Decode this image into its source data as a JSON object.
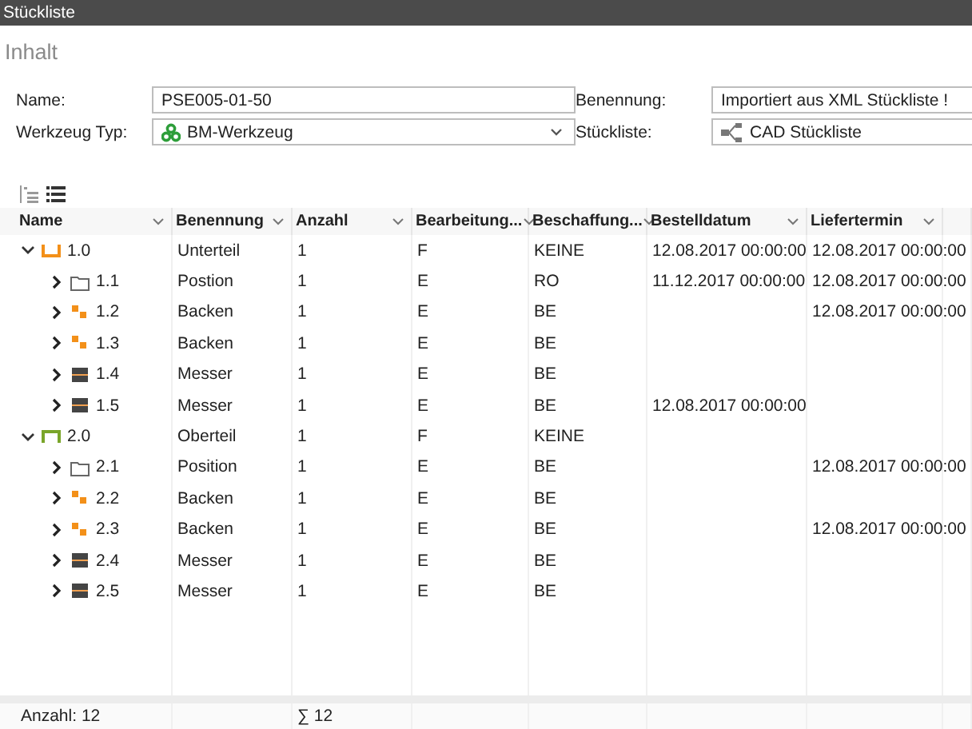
{
  "window": {
    "title": "Stückliste"
  },
  "section": {
    "title": "Inhalt"
  },
  "form": {
    "fields": [
      {
        "label": "Name:",
        "kind": "text",
        "value": "PSE005-01-50"
      },
      {
        "label": "Benennung:",
        "kind": "text",
        "value": "Importiert aus XML Stückliste !"
      },
      {
        "label": "Werkzeug Typ:",
        "kind": "combo",
        "value": "BM-Werkzeug"
      },
      {
        "label": "Stückliste:",
        "kind": "source",
        "value": "CAD Stückliste"
      }
    ]
  },
  "table": {
    "columns": [
      {
        "label": "Name"
      },
      {
        "label": "Benennung"
      },
      {
        "label": "Anzahl"
      },
      {
        "label": "Bearbeitung..."
      },
      {
        "label": "Beschaffung..."
      },
      {
        "label": "Bestelldatum"
      },
      {
        "label": "Liefertermin"
      }
    ],
    "rows": [
      {
        "name": "1.0",
        "kind": "lower-part",
        "expanded": true,
        "designation": "Unterteil",
        "quantity": "1",
        "machining": "F",
        "procurement": "KEINE",
        "order_date": "12.08.2017 00:00:00",
        "delivery_date": "12.08.2017 00:00:00",
        "children": [
          {
            "name": "1.1",
            "kind": "folder",
            "expanded": false,
            "designation": "Postion",
            "quantity": "1",
            "machining": "E",
            "procurement": "RO",
            "order_date": "11.12.2017 00:00:00",
            "delivery_date": "12.08.2017 00:00:00"
          },
          {
            "name": "1.2",
            "kind": "blocks",
            "expanded": false,
            "designation": "Backen",
            "quantity": "1",
            "machining": "E",
            "procurement": "BE",
            "delivery_date": "12.08.2017 00:00:00"
          },
          {
            "name": "1.3",
            "kind": "blocks",
            "expanded": false,
            "designation": "Backen",
            "quantity": "1",
            "machining": "E",
            "procurement": "BE"
          },
          {
            "name": "1.4",
            "kind": "blade",
            "expanded": false,
            "designation": "Messer",
            "quantity": "1",
            "machining": "E",
            "procurement": "BE"
          },
          {
            "name": "1.5",
            "kind": "blade",
            "expanded": false,
            "designation": "Messer",
            "quantity": "1",
            "machining": "E",
            "procurement": "BE",
            "order_date": "12.08.2017 00:00:00"
          }
        ]
      },
      {
        "name": "2.0",
        "kind": "upper-part",
        "expanded": true,
        "designation": "Oberteil",
        "quantity": "1",
        "machining": "F",
        "procurement": "KEINE",
        "children": [
          {
            "name": "2.1",
            "kind": "folder",
            "expanded": false,
            "designation": "Position",
            "quantity": "1",
            "machining": "E",
            "procurement": "BE",
            "delivery_date": "12.08.2017 00:00:00"
          },
          {
            "name": "2.2",
            "kind": "blocks",
            "expanded": false,
            "designation": "Backen",
            "quantity": "1",
            "machining": "E",
            "procurement": "BE"
          },
          {
            "name": "2.3",
            "kind": "blocks",
            "expanded": false,
            "designation": "Backen",
            "quantity": "1",
            "machining": "E",
            "procurement": "BE",
            "delivery_date": "12.08.2017 00:00:00"
          },
          {
            "name": "2.4",
            "kind": "blade",
            "expanded": false,
            "designation": "Messer",
            "quantity": "1",
            "machining": "E",
            "procurement": "BE"
          },
          {
            "name": "2.5",
            "kind": "blade",
            "expanded": false,
            "designation": "Messer",
            "quantity": "1",
            "machining": "E",
            "procurement": "BE"
          }
        ]
      }
    ]
  },
  "footer": {
    "count": "Anzahl: 12",
    "sum": "∑ 12"
  }
}
